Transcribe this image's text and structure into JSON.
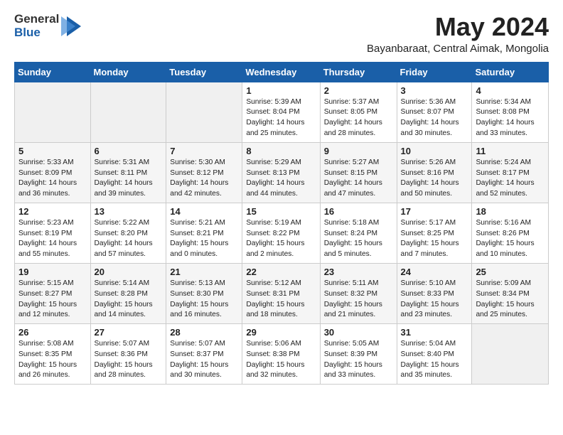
{
  "logo": {
    "general": "General",
    "blue": "Blue"
  },
  "title": "May 2024",
  "subtitle": "Bayanbaraat, Central Aimak, Mongolia",
  "weekdays": [
    "Sunday",
    "Monday",
    "Tuesday",
    "Wednesday",
    "Thursday",
    "Friday",
    "Saturday"
  ],
  "weeks": [
    [
      {
        "day": "",
        "info": ""
      },
      {
        "day": "",
        "info": ""
      },
      {
        "day": "",
        "info": ""
      },
      {
        "day": "1",
        "info": "Sunrise: 5:39 AM\nSunset: 8:04 PM\nDaylight: 14 hours\nand 25 minutes."
      },
      {
        "day": "2",
        "info": "Sunrise: 5:37 AM\nSunset: 8:05 PM\nDaylight: 14 hours\nand 28 minutes."
      },
      {
        "day": "3",
        "info": "Sunrise: 5:36 AM\nSunset: 8:07 PM\nDaylight: 14 hours\nand 30 minutes."
      },
      {
        "day": "4",
        "info": "Sunrise: 5:34 AM\nSunset: 8:08 PM\nDaylight: 14 hours\nand 33 minutes."
      }
    ],
    [
      {
        "day": "5",
        "info": "Sunrise: 5:33 AM\nSunset: 8:09 PM\nDaylight: 14 hours\nand 36 minutes."
      },
      {
        "day": "6",
        "info": "Sunrise: 5:31 AM\nSunset: 8:11 PM\nDaylight: 14 hours\nand 39 minutes."
      },
      {
        "day": "7",
        "info": "Sunrise: 5:30 AM\nSunset: 8:12 PM\nDaylight: 14 hours\nand 42 minutes."
      },
      {
        "day": "8",
        "info": "Sunrise: 5:29 AM\nSunset: 8:13 PM\nDaylight: 14 hours\nand 44 minutes."
      },
      {
        "day": "9",
        "info": "Sunrise: 5:27 AM\nSunset: 8:15 PM\nDaylight: 14 hours\nand 47 minutes."
      },
      {
        "day": "10",
        "info": "Sunrise: 5:26 AM\nSunset: 8:16 PM\nDaylight: 14 hours\nand 50 minutes."
      },
      {
        "day": "11",
        "info": "Sunrise: 5:24 AM\nSunset: 8:17 PM\nDaylight: 14 hours\nand 52 minutes."
      }
    ],
    [
      {
        "day": "12",
        "info": "Sunrise: 5:23 AM\nSunset: 8:19 PM\nDaylight: 14 hours\nand 55 minutes."
      },
      {
        "day": "13",
        "info": "Sunrise: 5:22 AM\nSunset: 8:20 PM\nDaylight: 14 hours\nand 57 minutes."
      },
      {
        "day": "14",
        "info": "Sunrise: 5:21 AM\nSunset: 8:21 PM\nDaylight: 15 hours\nand 0 minutes."
      },
      {
        "day": "15",
        "info": "Sunrise: 5:19 AM\nSunset: 8:22 PM\nDaylight: 15 hours\nand 2 minutes."
      },
      {
        "day": "16",
        "info": "Sunrise: 5:18 AM\nSunset: 8:24 PM\nDaylight: 15 hours\nand 5 minutes."
      },
      {
        "day": "17",
        "info": "Sunrise: 5:17 AM\nSunset: 8:25 PM\nDaylight: 15 hours\nand 7 minutes."
      },
      {
        "day": "18",
        "info": "Sunrise: 5:16 AM\nSunset: 8:26 PM\nDaylight: 15 hours\nand 10 minutes."
      }
    ],
    [
      {
        "day": "19",
        "info": "Sunrise: 5:15 AM\nSunset: 8:27 PM\nDaylight: 15 hours\nand 12 minutes."
      },
      {
        "day": "20",
        "info": "Sunrise: 5:14 AM\nSunset: 8:28 PM\nDaylight: 15 hours\nand 14 minutes."
      },
      {
        "day": "21",
        "info": "Sunrise: 5:13 AM\nSunset: 8:30 PM\nDaylight: 15 hours\nand 16 minutes."
      },
      {
        "day": "22",
        "info": "Sunrise: 5:12 AM\nSunset: 8:31 PM\nDaylight: 15 hours\nand 18 minutes."
      },
      {
        "day": "23",
        "info": "Sunrise: 5:11 AM\nSunset: 8:32 PM\nDaylight: 15 hours\nand 21 minutes."
      },
      {
        "day": "24",
        "info": "Sunrise: 5:10 AM\nSunset: 8:33 PM\nDaylight: 15 hours\nand 23 minutes."
      },
      {
        "day": "25",
        "info": "Sunrise: 5:09 AM\nSunset: 8:34 PM\nDaylight: 15 hours\nand 25 minutes."
      }
    ],
    [
      {
        "day": "26",
        "info": "Sunrise: 5:08 AM\nSunset: 8:35 PM\nDaylight: 15 hours\nand 26 minutes."
      },
      {
        "day": "27",
        "info": "Sunrise: 5:07 AM\nSunset: 8:36 PM\nDaylight: 15 hours\nand 28 minutes."
      },
      {
        "day": "28",
        "info": "Sunrise: 5:07 AM\nSunset: 8:37 PM\nDaylight: 15 hours\nand 30 minutes."
      },
      {
        "day": "29",
        "info": "Sunrise: 5:06 AM\nSunset: 8:38 PM\nDaylight: 15 hours\nand 32 minutes."
      },
      {
        "day": "30",
        "info": "Sunrise: 5:05 AM\nSunset: 8:39 PM\nDaylight: 15 hours\nand 33 minutes."
      },
      {
        "day": "31",
        "info": "Sunrise: 5:04 AM\nSunset: 8:40 PM\nDaylight: 15 hours\nand 35 minutes."
      },
      {
        "day": "",
        "info": ""
      }
    ]
  ]
}
